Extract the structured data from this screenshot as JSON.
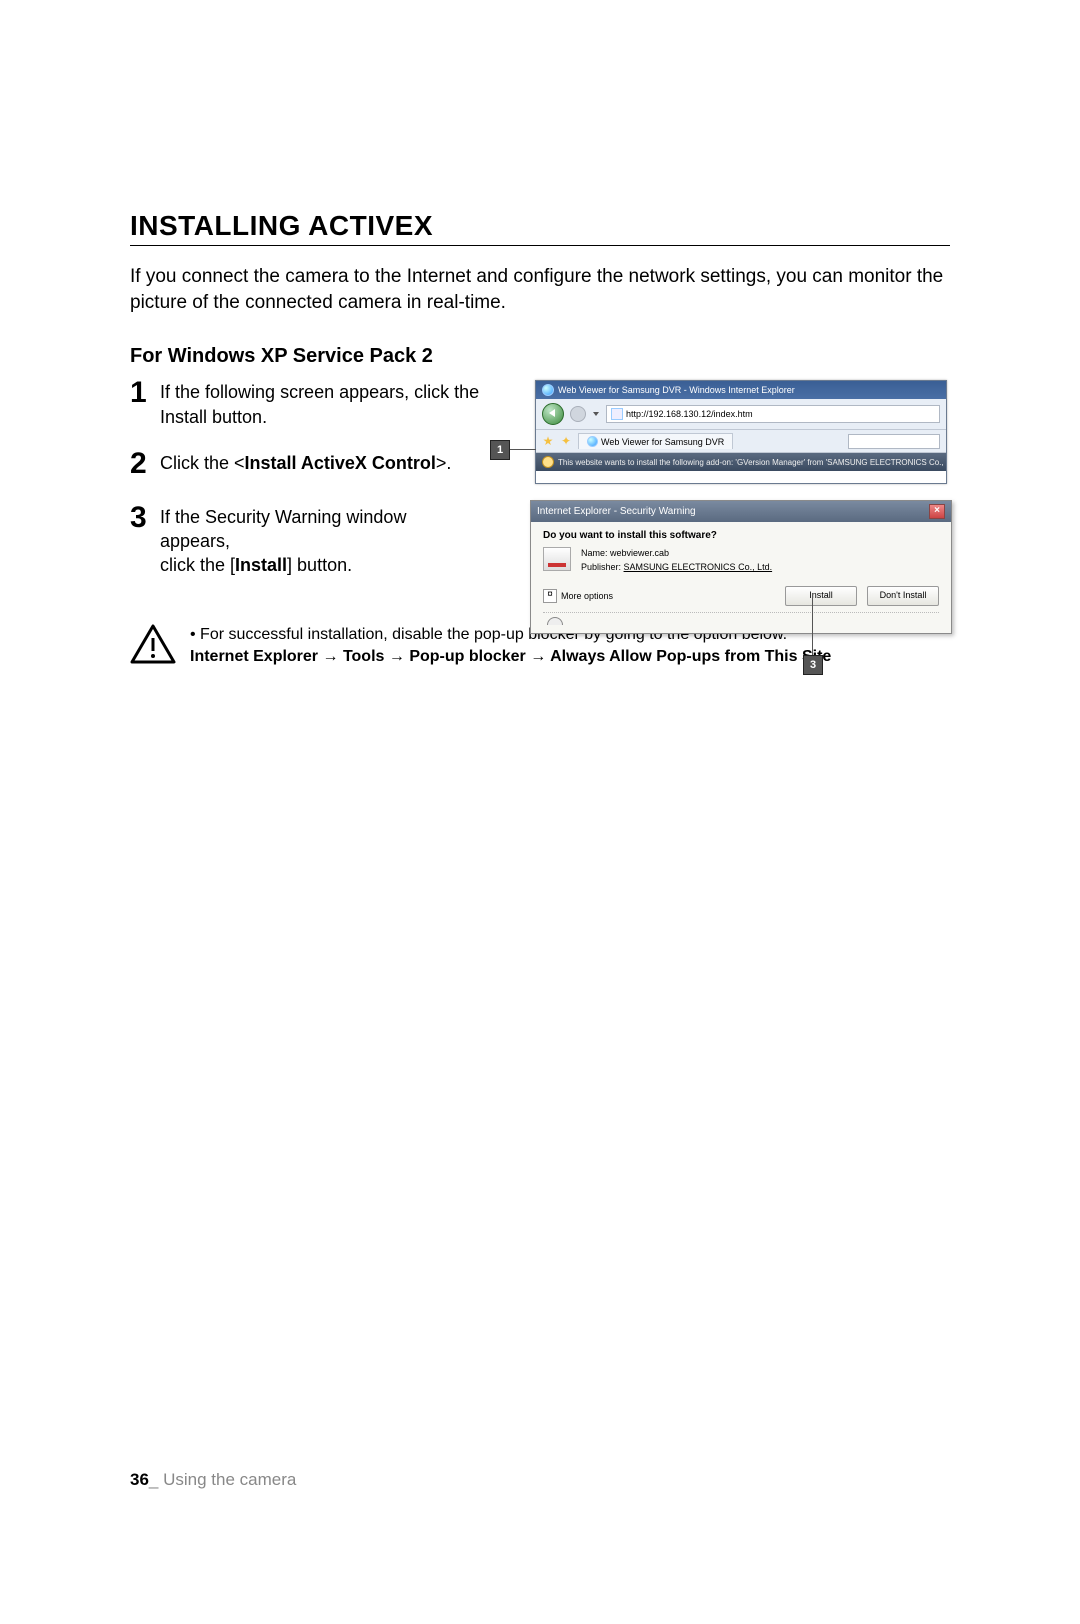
{
  "section_title": "INSTALLING ACTIVEX",
  "intro": "If you connect the camera to the Internet and configure the network settings, you can monitor the picture of the connected camera in real-time.",
  "subhead": "For Windows XP Service Pack 2",
  "steps": {
    "s1": {
      "num": "1",
      "text": "If the following screen appears, click the Install button."
    },
    "s2": {
      "num": "2",
      "prefix": "Click the <",
      "bold": "Install ActiveX Control",
      "suffix": ">."
    },
    "s3": {
      "num": "3",
      "line1": "If the Security Warning window appears,",
      "line2a": "click the [",
      "bold": "Install",
      "line2b": "] button."
    }
  },
  "callouts": {
    "c1": "1",
    "c3": "3"
  },
  "ie": {
    "title": "Web Viewer for Samsung DVR - Windows Internet Explorer",
    "url": "http://192.168.130.12/index.htm",
    "tab": "Web Viewer for Samsung DVR",
    "infobar": "This website wants to install the following add-on: 'GVersion Manager' from 'SAMSUNG ELECTRONICS Co., Ltd.'"
  },
  "sec": {
    "title": "Internet Explorer - Security Warning",
    "question": "Do you want to install this software?",
    "name_label": "Name:",
    "name_value": "webviewer.cab",
    "pub_label": "Publisher:",
    "pub_value": "SAMSUNG ELECTRONICS Co., Ltd.",
    "more": "More options",
    "install": "Install",
    "dont_install": "Don't Install"
  },
  "note": {
    "line1": "For successful installation, disable the pop-up blocker by going to the option below.",
    "path": {
      "p1": "Internet Explorer",
      "p2": "Tools",
      "p3": "Pop-up blocker",
      "p4": "Always Allow Pop-ups from This Site"
    },
    "arrow": "→"
  },
  "footer": {
    "page": "36",
    "sep": "_",
    "chapter": "Using the camera"
  }
}
